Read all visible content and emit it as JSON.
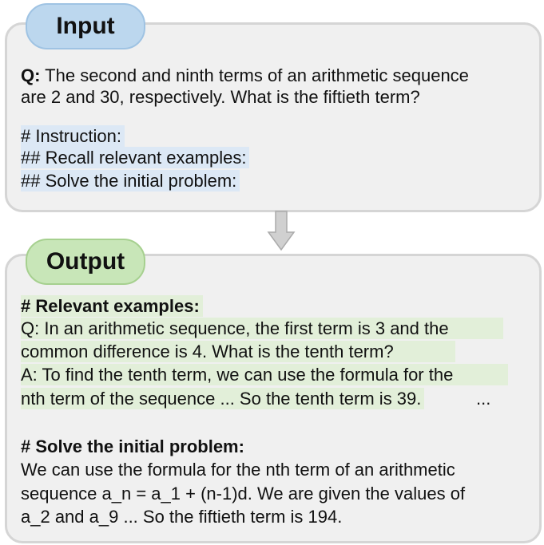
{
  "input": {
    "label": "Input",
    "q_label": "Q:",
    "q_lines": [
      " The second and ninth terms of an arithmetic sequence",
      "are 2 and 30, respectively. What is the fiftieth term?"
    ],
    "instruction_lines": [
      "# Instruction:",
      "## Recall relevant examples:",
      "## Solve the initial problem:"
    ]
  },
  "output": {
    "label": "Output",
    "examples_heading": "# Relevant examples:",
    "example_lines": [
      "Q: In an arithmetic sequence, the first term is 3 and the",
      "common difference is 4. What is the tenth term?",
      "A: To find the tenth term, we can use the formula for the",
      "nth term of the sequence ... So the tenth term is 39."
    ],
    "ellipsis": "...",
    "solve_heading": "# Solve the initial problem:",
    "solve_lines": [
      "We can use the formula for the nth term of an arithmetic",
      "sequence a_n = a_1 + (n-1)d. We are given the values of",
      "a_2 and a_9 ... So the fiftieth term is 194."
    ]
  },
  "colors": {
    "input_pill": "#bcd7ee",
    "output_pill": "#c8e6b8",
    "input_highlight": "#dce8f5",
    "output_highlight": "#e2efd9",
    "box_bg": "#f0f0f0"
  }
}
